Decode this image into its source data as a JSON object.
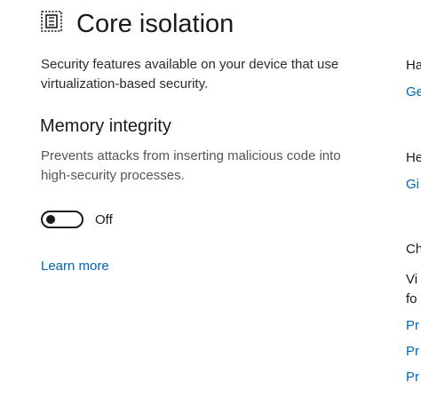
{
  "page": {
    "title": "Core isolation",
    "description": "Security features available on your device that use virtualization-based security.",
    "icon": "core-isolation-chip-icon"
  },
  "memory_integrity": {
    "title": "Memory integrity",
    "description": "Prevents attacks from inserting malicious code into high-security processes.",
    "toggle": {
      "on": false,
      "state_label": "Off"
    },
    "learn_more": "Learn more"
  },
  "right_panel": {
    "section1_heading": "Ha",
    "section1_link": "Ge",
    "section2_heading": "He",
    "section2_link": "Gi",
    "section3_heading": "Ch",
    "section3_text_line1": "Vi",
    "section3_text_line2": "fo",
    "section3_link1": "Pr",
    "section3_link2": "Pr",
    "section3_link3": "Pr"
  },
  "colors": {
    "link": "#0067b8",
    "text": "#1a1a1a",
    "muted_text": "#555555",
    "background": "#ffffff"
  }
}
